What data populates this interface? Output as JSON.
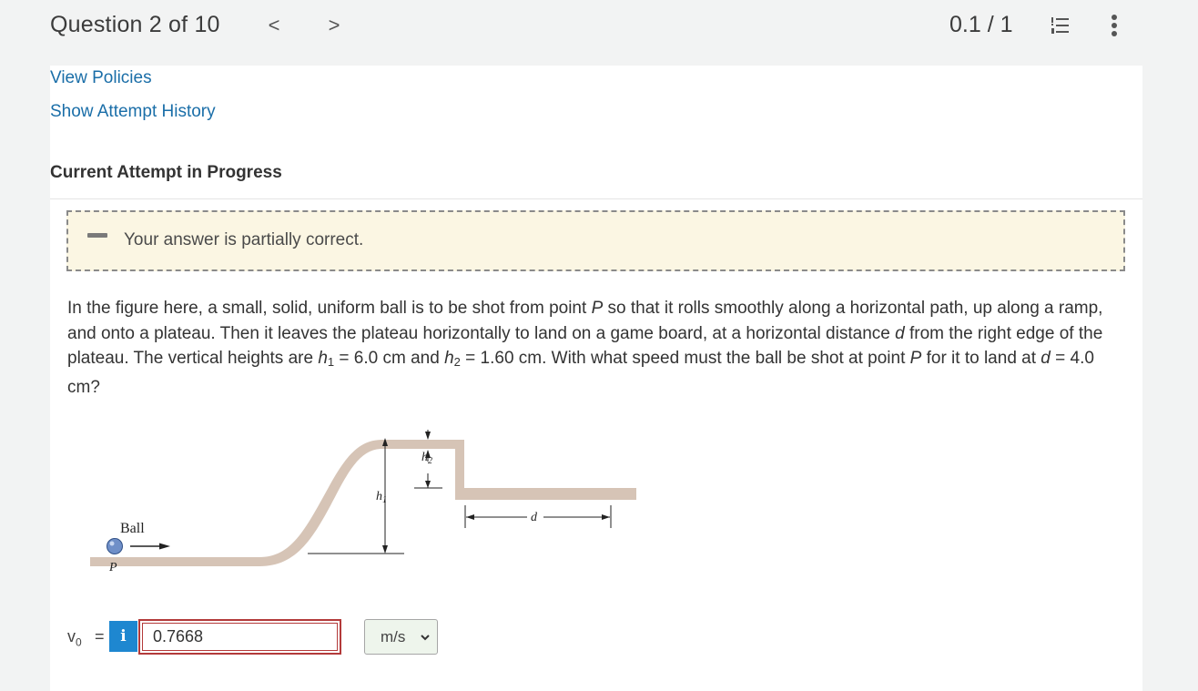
{
  "header": {
    "question_counter": "Question 2 of 10",
    "prev_glyph": "<",
    "next_glyph": ">",
    "score": "0.1 / 1",
    "list_icon": "numbered-list-icon",
    "more_icon": "vertical-ellipsis-icon"
  },
  "links": {
    "view_policies": "View Policies",
    "attempt_history": "Show Attempt History"
  },
  "attempt": {
    "heading": "Current Attempt in Progress"
  },
  "feedback": {
    "message": "Your answer is partially correct.",
    "status": "partial",
    "colors": {
      "background": "#fbf6e3",
      "border": "#8a8a8a"
    }
  },
  "problem": {
    "intro": "In the figure here, a small, solid, uniform ball is to be shot from point ",
    "point": "P",
    "text2": " so that it rolls smoothly along a horizontal path, up along a ramp, and onto a plateau. Then it leaves the plateau horizontally to land on a game board, at a horizontal distance ",
    "dvar": "d",
    "text3": " from the right edge of the plateau. The vertical heights are ",
    "h1var": "h",
    "h1sub": "1",
    "h1val": " = 6.0 cm and ",
    "h2var": "h",
    "h2sub": "2",
    "h2val": " = 1.60 cm. With what speed must the ball be shot at point ",
    "point2": "P",
    "text4": " for it to land at ",
    "dvar2": "d",
    "dval": " = 4.0 cm?"
  },
  "figure": {
    "ball_label": "Ball",
    "p_label": "P",
    "h1_label": "h",
    "h1_sub": "1",
    "h2_label": "h",
    "h2_sub": "2",
    "d_label": "d",
    "colors": {
      "track": "#d6c4b6",
      "ball": "#6f8fc8"
    }
  },
  "answer": {
    "var_label": "v",
    "var_sub": "0",
    "equals": "=",
    "info_glyph": "i",
    "value": "0.7668",
    "unit": "m/s",
    "colors": {
      "info": "#1e87d0",
      "input_border": "#b33a3a",
      "select_bg": "#eef5ec"
    }
  }
}
